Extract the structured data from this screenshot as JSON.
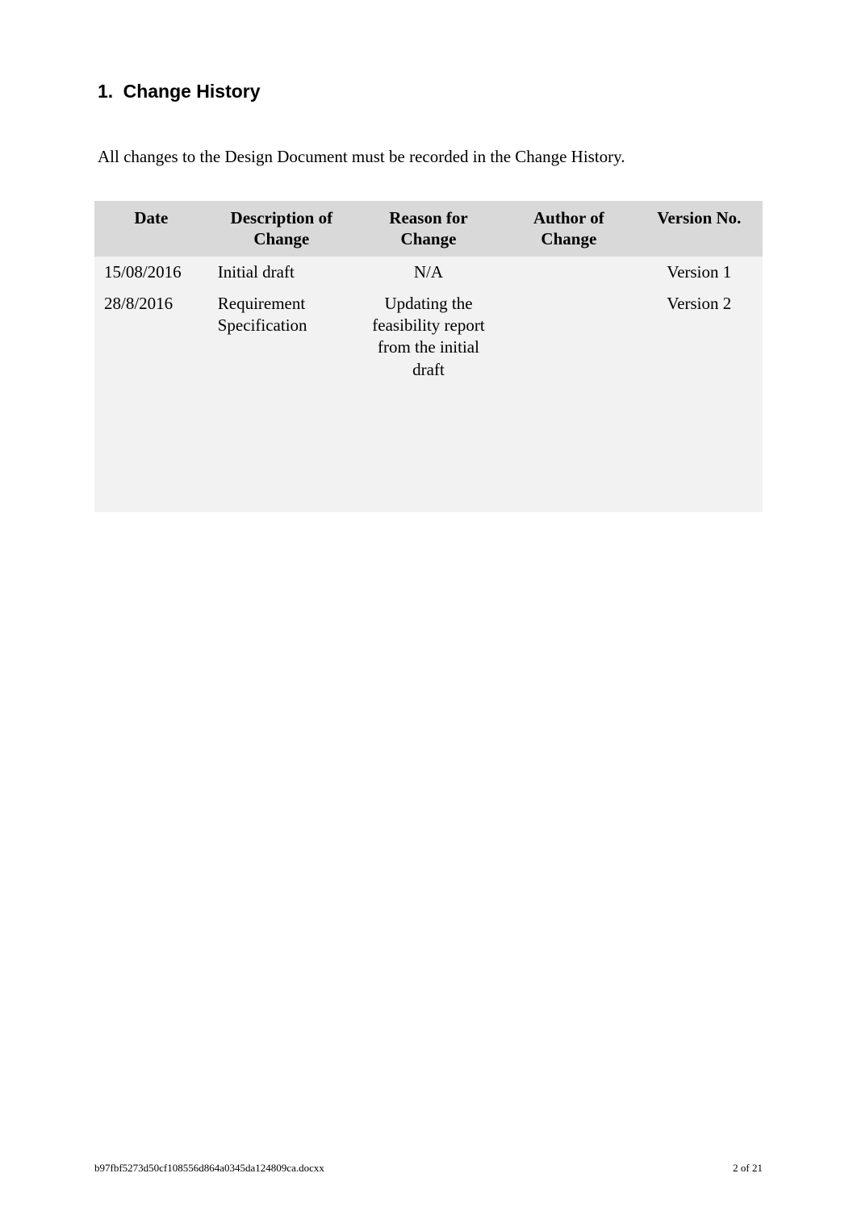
{
  "heading_number": "1.",
  "heading_title": "Change History",
  "intro_text": "All changes to the Design Document must be recorded in the Change History.",
  "table": {
    "headers": {
      "date": "Date",
      "description": "Description of Change",
      "reason": "Reason for Change",
      "author": "Author of Change",
      "version": "Version No."
    },
    "rows": [
      {
        "date": "15/08/2016",
        "description": "Initial draft",
        "reason": "N/A",
        "author": "",
        "version": "Version 1"
      },
      {
        "date": "28/8/2016",
        "description": "Requirement Specification",
        "reason": "Updating the feasibility report from the initial draft",
        "author": "",
        "version": "Version 2"
      },
      {
        "date": "",
        "description": "",
        "reason": "",
        "author": "",
        "version": ""
      },
      {
        "date": "",
        "description": "",
        "reason": "",
        "author": "",
        "version": ""
      },
      {
        "date": "",
        "description": "",
        "reason": "",
        "author": "",
        "version": ""
      },
      {
        "date": "",
        "description": "",
        "reason": "",
        "author": "",
        "version": ""
      }
    ]
  },
  "footer": {
    "filename": "b97fbf5273d50cf108556d864a0345da124809ca.docxx",
    "page_info": "2 of 21"
  }
}
